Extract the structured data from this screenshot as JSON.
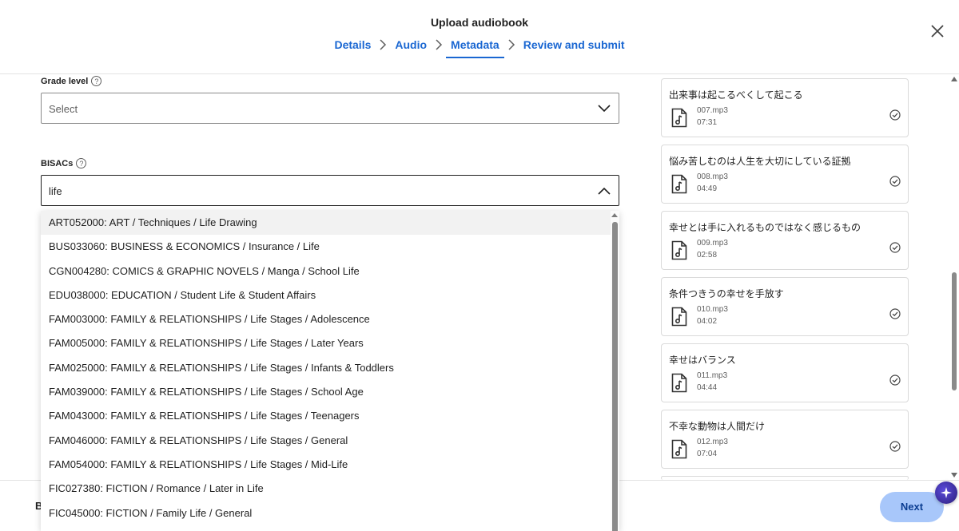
{
  "header": {
    "title": "Upload audiobook",
    "steps": [
      {
        "label": "Details"
      },
      {
        "label": "Audio"
      },
      {
        "label": "Metadata"
      },
      {
        "label": "Review and submit"
      }
    ],
    "active_step": "Metadata"
  },
  "grade_level": {
    "label": "Grade level",
    "help": "?",
    "value": "Select"
  },
  "bisacs": {
    "label": "BISACs",
    "help": "?",
    "query": "life",
    "options": [
      "ART052000: ART / Techniques / Life Drawing",
      "BUS033060: BUSINESS & ECONOMICS / Insurance / Life",
      "CGN004280: COMICS & GRAPHIC NOVELS / Manga / School Life",
      "EDU038000: EDUCATION / Student Life & Student Affairs",
      "FAM003000: FAMILY & RELATIONSHIPS / Life Stages / Adolescence",
      "FAM005000: FAMILY & RELATIONSHIPS / Life Stages / Later Years",
      "FAM025000: FAMILY & RELATIONSHIPS / Life Stages / Infants & Toddlers",
      "FAM039000: FAMILY & RELATIONSHIPS / Life Stages / School Age",
      "FAM043000: FAMILY & RELATIONSHIPS / Life Stages / Teenagers",
      "FAM046000: FAMILY & RELATIONSHIPS / Life Stages / General",
      "FAM054000: FAMILY & RELATIONSHIPS / Life Stages / Mid-Life",
      "FIC027380: FICTION / Romance / Later in Life",
      "FIC045000: FICTION / Family Life / General"
    ]
  },
  "chapters": [
    {
      "title": "出来事は起こるべくして起こる",
      "file": "007.mp3",
      "duration": "07:31"
    },
    {
      "title": "悩み苦しむのは人生を大切にしている証拠",
      "file": "008.mp3",
      "duration": "04:49"
    },
    {
      "title": "幸せとは手に入れるものではなく感じるもの",
      "file": "009.mp3",
      "duration": "02:58"
    },
    {
      "title": "条件つきうの幸せを手放す",
      "file": "010.mp3",
      "duration": "04:02"
    },
    {
      "title": "幸せはバランス",
      "file": "011.mp3",
      "duration": "04:44"
    },
    {
      "title": "不幸な動物は人間だけ",
      "file": "012.mp3",
      "duration": "07:04"
    }
  ],
  "footer": {
    "back_peek": "B",
    "next_label": "Next"
  },
  "colors": {
    "accent": "#1a67d2",
    "next_button": "#a8c7fa"
  }
}
